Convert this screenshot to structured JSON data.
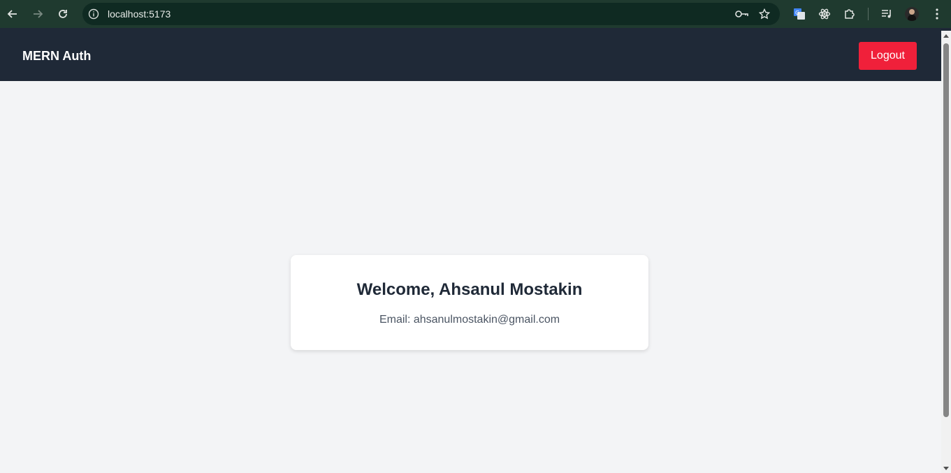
{
  "browser": {
    "url": "localhost:5173"
  },
  "navbar": {
    "brand": "MERN Auth",
    "logout_label": "Logout"
  },
  "card": {
    "welcome": "Welcome, Ahsanul Mostakin",
    "email": "Email: ahsanulmostakin@gmail.com"
  },
  "colors": {
    "navbar_bg": "#1f2937",
    "logout_bg": "#f0203a",
    "page_bg": "#f3f4f6",
    "chrome_bg": "#1f3a2f"
  },
  "icons": {
    "back": "arrow-left-icon",
    "forward": "arrow-right-icon",
    "reload": "reload-icon",
    "site_info": "info-icon",
    "password": "key-icon",
    "bookmark": "star-icon",
    "translate": "google-translate-icon",
    "react_devtools": "react-icon",
    "extensions": "puzzle-icon",
    "media": "media-queue-icon",
    "profile": "avatar",
    "menu": "kebab-menu-icon"
  }
}
